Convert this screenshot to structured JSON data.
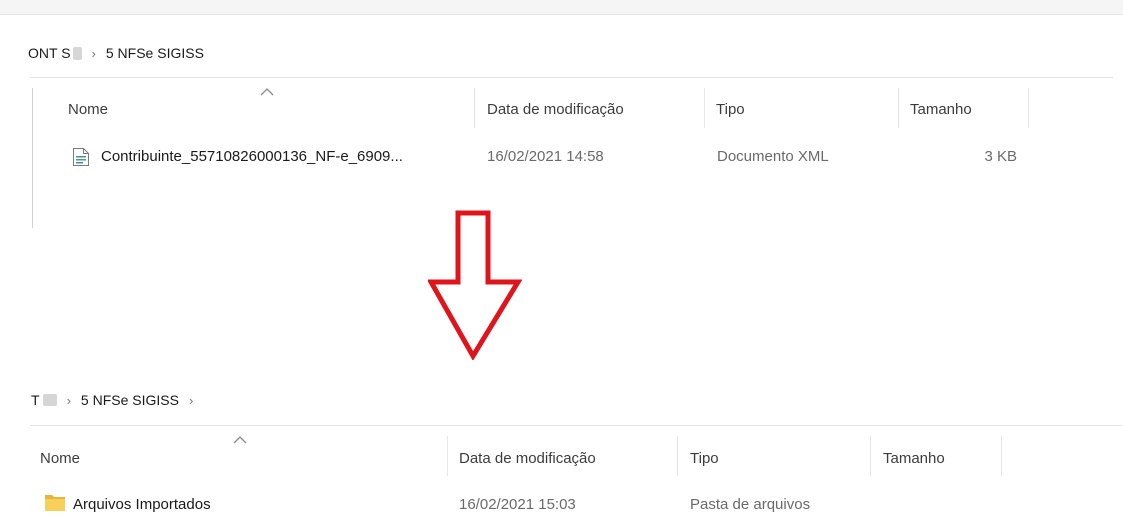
{
  "top_window": {
    "breadcrumb": {
      "prefix": "ONT S",
      "separator": "›",
      "folder": "5 NFSe SIGISS"
    },
    "columns": {
      "name": "Nome",
      "modified": "Data de modificação",
      "type": "Tipo",
      "size": "Tamanho"
    },
    "rows": [
      {
        "name": "Contribuinte_55710826000136_NF-e_6909...",
        "modified": "16/02/2021 14:58",
        "type": "Documento XML",
        "size": "3 KB",
        "icon": "xml-file-icon"
      }
    ]
  },
  "arrow": {
    "color": "#e0151c",
    "direction": "down"
  },
  "bottom_window": {
    "breadcrumb": {
      "prefix": "T",
      "separator": "›",
      "folder": "5 NFSe SIGISS",
      "trailing": "›"
    },
    "columns": {
      "name": "Nome",
      "modified": "Data de modificação",
      "type": "Tipo",
      "size": "Tamanho"
    },
    "rows": [
      {
        "name": "Arquivos Importados",
        "modified": "16/02/2021 15:03",
        "type": "Pasta de arquivos",
        "icon": "folder-icon"
      }
    ]
  }
}
